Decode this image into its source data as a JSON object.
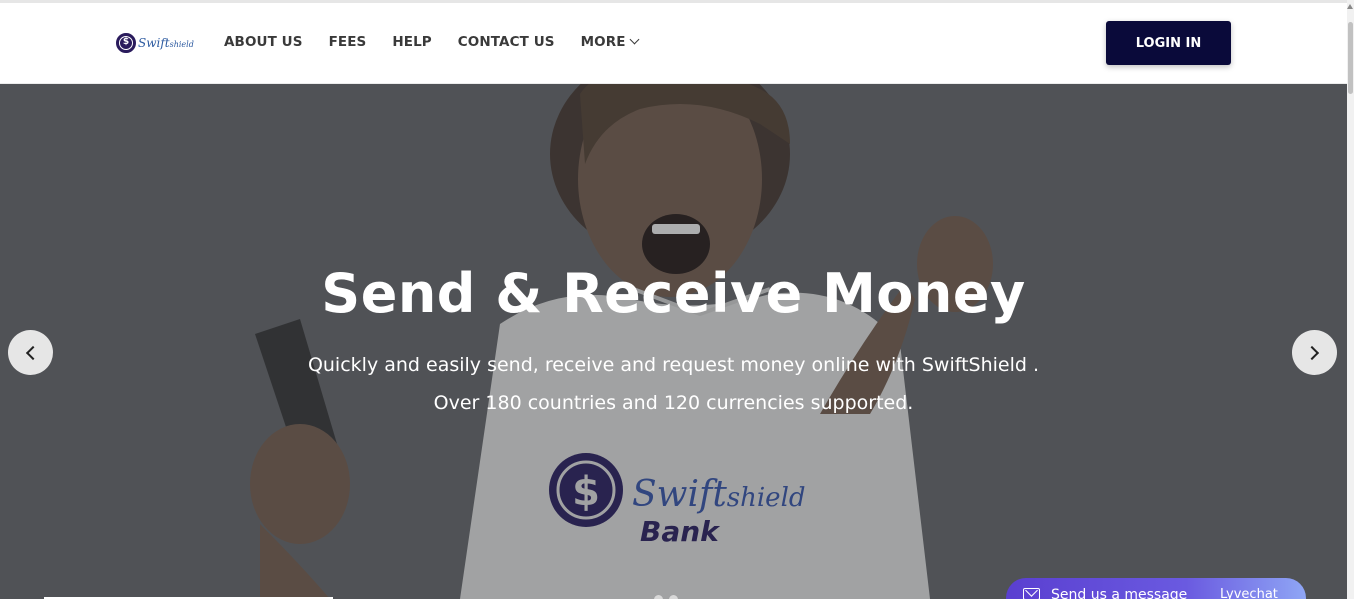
{
  "brand": {
    "logo_alt": "Swiftshield",
    "logo_word_main": "Swift",
    "logo_word_small": "shield"
  },
  "nav": {
    "items": [
      "ABOUT US",
      "FEES",
      "HELP",
      "CONTACT US",
      "MORE"
    ],
    "login_label": "LOGIN IN"
  },
  "hero": {
    "title": "Send & Receive Money",
    "subtitle_line1": "Quickly and easily send, receive and request money online with SwiftShield .",
    "subtitle_line2": "Over 180 countries and 120 currencies supported.",
    "shirt_brand_main": "Swift",
    "shirt_brand_small": "shield",
    "shirt_brand_bank": "Bank",
    "slide_count": 2
  },
  "chat": {
    "message_label": "Send us a message",
    "brand": "Lyvechat"
  },
  "icons": {
    "prev": "chevron-left-icon",
    "next": "chevron-right-icon",
    "more": "chevron-down-icon",
    "mail": "envelope-icon",
    "logo": "dollar-shield-icon"
  },
  "colors": {
    "login_bg": "#0a0a3a",
    "brand_blue": "#2c5aa0",
    "brand_purple": "#2a1b5c",
    "chat_gradient_start": "#5a3fd0"
  }
}
